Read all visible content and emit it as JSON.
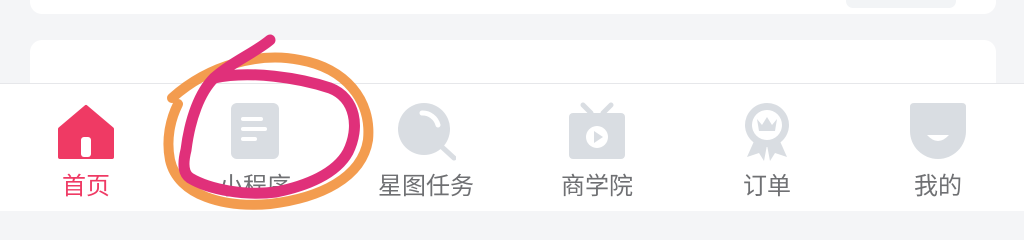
{
  "colors": {
    "active": "#ef3a64",
    "inactive_icon": "#d9dde2",
    "label": "#6f7073",
    "annotation_pink": "#e0307a",
    "annotation_orange": "#f2913c"
  },
  "tab_bar": {
    "tabs": [
      {
        "label": "首页",
        "icon": "home-icon",
        "active": true
      },
      {
        "label": "小程序",
        "icon": "mini-program-icon",
        "active": false
      },
      {
        "label": "星图任务",
        "icon": "search-magnifier-icon",
        "active": false
      },
      {
        "label": "商学院",
        "icon": "tv-play-icon",
        "active": false
      },
      {
        "label": "订单",
        "icon": "award-badge-icon",
        "active": false
      },
      {
        "label": "我的",
        "icon": "profile-face-icon",
        "active": false
      }
    ]
  }
}
